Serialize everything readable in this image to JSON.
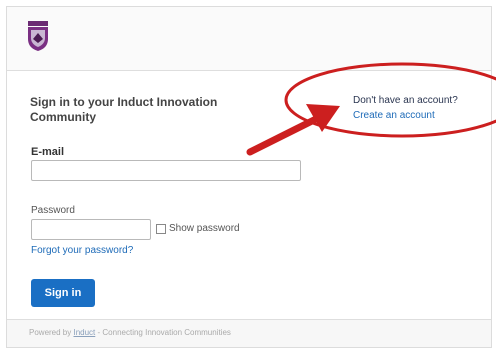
{
  "signin": {
    "title": "Sign in to your Induct Innovation Community"
  },
  "account": {
    "question": "Don't have an account?",
    "create_link": "Create an account"
  },
  "form": {
    "email_label": "E-mail",
    "email_value": "",
    "password_label": "Password",
    "password_value": "",
    "show_password_label": "Show password",
    "forgot_link": "Forgot your password?",
    "signin_button": "Sign in"
  },
  "footer": {
    "prefix": "Powered by",
    "link": "Induct",
    "suffix": "- Connecting Innovation Communities"
  },
  "annotation": {
    "circle_color": "#cc1f1f",
    "arrow_color": "#cc1f1f"
  },
  "colors": {
    "accent": "#1a6fc4",
    "link": "#1e6bb8"
  }
}
